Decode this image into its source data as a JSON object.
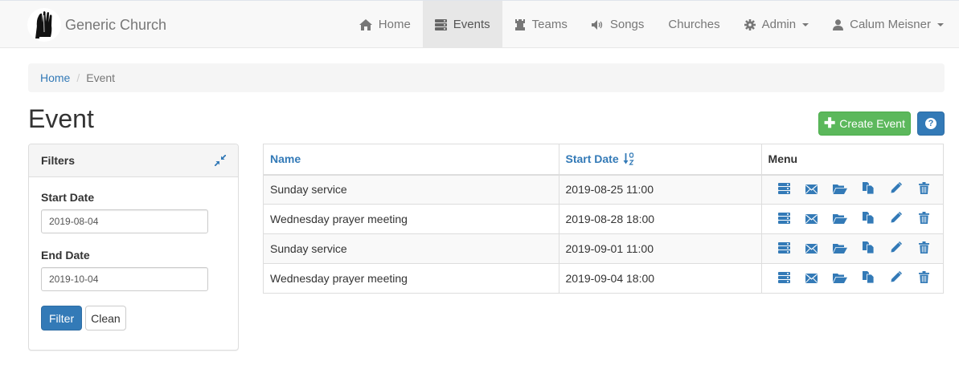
{
  "brand": {
    "name": "Generic Church"
  },
  "nav": {
    "items": [
      {
        "label": "Home",
        "icon": "home-icon"
      },
      {
        "label": "Events",
        "icon": "server-icon",
        "active": true
      },
      {
        "label": "Teams",
        "icon": "tower-icon"
      },
      {
        "label": "Songs",
        "icon": "volume-icon"
      },
      {
        "label": "Churches"
      },
      {
        "label": "Admin",
        "icon": "cog-icon",
        "dropdown": true
      },
      {
        "label": "Calum Meisner",
        "icon": "user-icon",
        "dropdown": true
      }
    ]
  },
  "breadcrumb": {
    "home": "Home",
    "current": "Event"
  },
  "page": {
    "title": "Event",
    "create_label": "Create Event",
    "help_label": "?"
  },
  "filters": {
    "title": "Filters",
    "start_label": "Start Date",
    "start_value": "2019-08-04",
    "end_label": "End Date",
    "end_value": "2019-10-04",
    "filter_button": "Filter",
    "clean_button": "Clean"
  },
  "table": {
    "columns": {
      "name": "Name",
      "start": "Start Date",
      "menu": "Menu"
    },
    "sort_column": "Start Date",
    "sort_direction": "ascending",
    "rows": [
      {
        "name": "Sunday service",
        "start": "2019-08-25 11:00"
      },
      {
        "name": "Wednesday prayer meeting",
        "start": "2019-08-28 18:00"
      },
      {
        "name": "Sunday service",
        "start": "2019-09-01 11:00"
      },
      {
        "name": "Wednesday prayer meeting",
        "start": "2019-09-04 18:00"
      }
    ],
    "row_actions": [
      "tasks-icon",
      "envelope-icon",
      "folder-open-icon",
      "copy-icon",
      "pencil-icon",
      "trash-icon"
    ]
  },
  "colors": {
    "primary": "#337ab7",
    "success": "#5cb85c",
    "navbar_bg": "#f8f8f8",
    "active_nav_bg": "#e7e7e7"
  }
}
